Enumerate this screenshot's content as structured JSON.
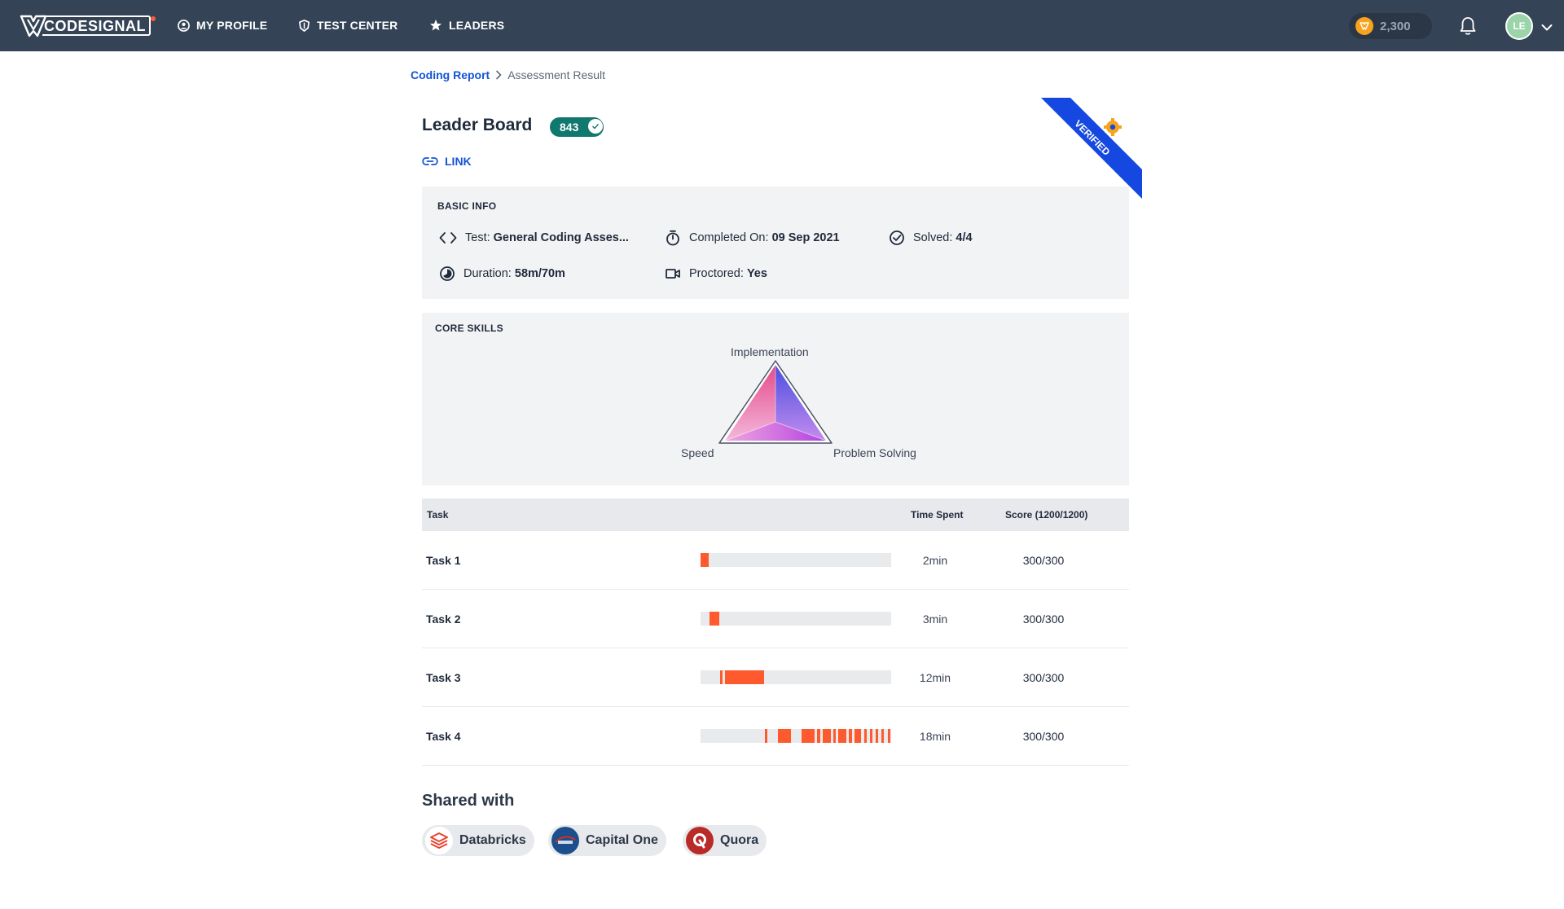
{
  "nav": {
    "logo_text": "CODESIGNAL",
    "items": [
      "MY PROFILE",
      "TEST CENTER",
      "LEADERS"
    ],
    "coins": "2,300",
    "avatar_initials": "LE"
  },
  "breadcrumb": {
    "link": "Coding Report",
    "current": "Assessment Result"
  },
  "header": {
    "title": "Leader Board",
    "score": "843",
    "link_label": "LINK",
    "ribbon_label": "VERIFIED"
  },
  "basic_info": {
    "title": "BASIC INFO",
    "test_label": "Test:",
    "test_value": "General Coding Asses...",
    "completed_label": "Completed On:",
    "completed_value": "09 Sep 2021",
    "solved_label": "Solved:",
    "solved_value": "4/4",
    "duration_label": "Duration:",
    "duration_value": "58m/70m",
    "proctored_label": "Proctored:",
    "proctored_value": "Yes"
  },
  "core_skills": {
    "title": "CORE SKILLS",
    "labels": [
      "Implementation",
      "Speed",
      "Problem Solving"
    ]
  },
  "tasks": {
    "headers": {
      "task": "Task",
      "time": "Time Spent",
      "score": "Score (1200/1200)"
    },
    "rows": [
      {
        "name": "Task 1",
        "time": "2min",
        "score": "300/300"
      },
      {
        "name": "Task 2",
        "time": "3min",
        "score": "300/300"
      },
      {
        "name": "Task 3",
        "time": "12min",
        "score": "300/300"
      },
      {
        "name": "Task 4",
        "time": "18min",
        "score": "300/300"
      }
    ]
  },
  "shared": {
    "title": "Shared with",
    "companies": [
      "Databricks",
      "Capital One",
      "Quora"
    ]
  },
  "colors": {
    "nav_bg": "#344356",
    "accent_blue": "#1454d6",
    "score_green": "#10786e",
    "bar_orange": "#ff5a2e",
    "card_bg": "#f2f3f5"
  }
}
